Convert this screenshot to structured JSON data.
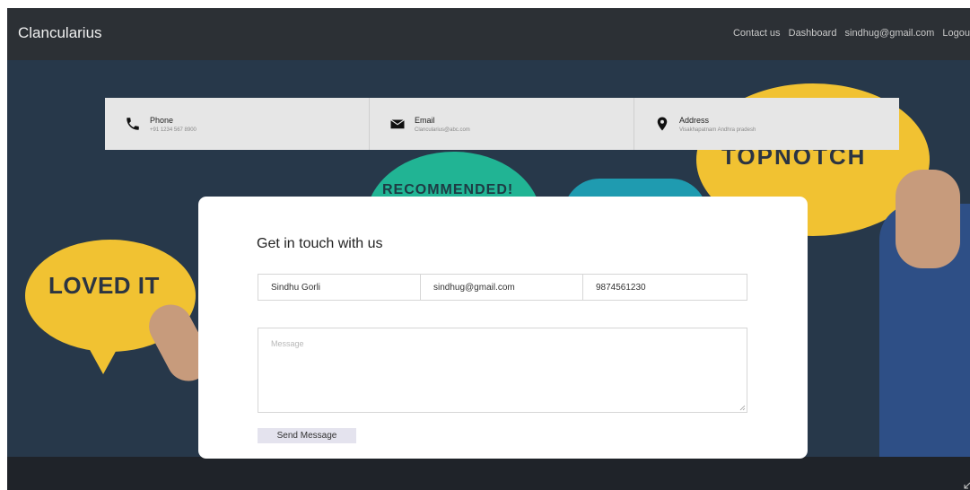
{
  "navbar": {
    "brand": "Clancularius",
    "links": [
      "Contact us",
      "Dashboard",
      "sindhug@gmail.com",
      "Logou"
    ]
  },
  "hero": {
    "bubble_left_text": "LOVED IT",
    "bubble_center_text": "RECOMMENDED!",
    "bubble_right_text": "TOPNOTCH"
  },
  "contact_info": {
    "phone": {
      "title": "Phone",
      "value": "+91 1234 567 8900",
      "icon": "phone-icon"
    },
    "email": {
      "title": "Email",
      "value": "Clancularius@abc.com",
      "icon": "envelope-icon"
    },
    "address": {
      "title": "Address",
      "value": "Visakhapatnam Andhra pradesh",
      "icon": "map-pin-icon"
    }
  },
  "form": {
    "heading": "Get in touch with us",
    "name_value": "Sindhu Gorli",
    "email_value": "sindhug@gmail.com",
    "phone_value": "9874561230",
    "message_placeholder": "Message",
    "submit_label": "Send Message"
  },
  "colors": {
    "topbar": "#2c3035",
    "hero_background": "#27384a",
    "bubble_yellow": "#f1c232",
    "bubble_green": "#21b494",
    "bubble_teal": "#1f9bb0",
    "info_bar": "#e6e6e6",
    "send_button": "#e4e3ee"
  }
}
